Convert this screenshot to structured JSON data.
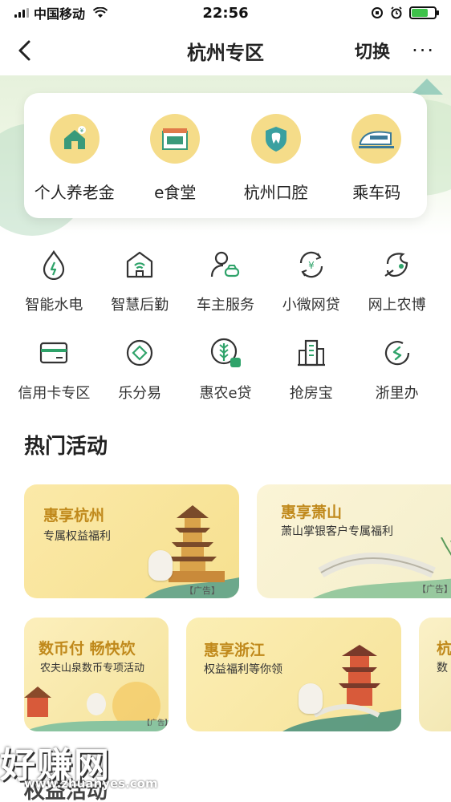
{
  "status": {
    "carrier": "中国移动",
    "time": "22:56"
  },
  "nav": {
    "back_icon": "chevron-left-icon",
    "title": "杭州专区",
    "switch_label": "切换",
    "more_label": "···"
  },
  "quick": [
    {
      "label": "个人养老金",
      "icon": "house-coin-icon"
    },
    {
      "label": "e食堂",
      "icon": "canteen-icon"
    },
    {
      "label": "杭州口腔",
      "icon": "tooth-shield-icon"
    },
    {
      "label": "乘车码",
      "icon": "train-icon"
    }
  ],
  "grid": [
    {
      "label": "智能水电",
      "icon": "water-drop-icon"
    },
    {
      "label": "智慧后勤",
      "icon": "smart-building-icon"
    },
    {
      "label": "车主服务",
      "icon": "car-owner-icon"
    },
    {
      "label": "小微网贷",
      "icon": "yuan-cycle-icon"
    },
    {
      "label": "网上农博",
      "icon": "farm-leaf-icon"
    },
    {
      "label": "信用卡专区",
      "icon": "credit-card-icon"
    },
    {
      "label": "乐分易",
      "icon": "diamond-circle-icon"
    },
    {
      "label": "惠农e贷",
      "icon": "wheat-icon"
    },
    {
      "label": "抢房宝",
      "icon": "buildings-icon"
    },
    {
      "label": "浙里办",
      "icon": "zhe-circle-icon"
    }
  ],
  "hot": {
    "title": "热门活动",
    "cards": [
      {
        "title": "惠享杭州",
        "subtitle": "专属权益福利",
        "ad": "【广告】"
      },
      {
        "title": "惠享萧山",
        "subtitle": "萧山掌银客户专属福利",
        "ad": "【广告】"
      },
      {
        "title": "数币付 畅快饮",
        "subtitle": "农夫山泉数币专项活动",
        "ad": "【广告】"
      },
      {
        "title": "惠享浙江",
        "subtitle": "权益福利等你领",
        "ad": ""
      },
      {
        "title": "杭",
        "subtitle": "数",
        "ad": ""
      }
    ]
  },
  "next_section": "权益活动",
  "watermark": {
    "text": "好赚网",
    "url": "www.zhuanyes.com"
  }
}
